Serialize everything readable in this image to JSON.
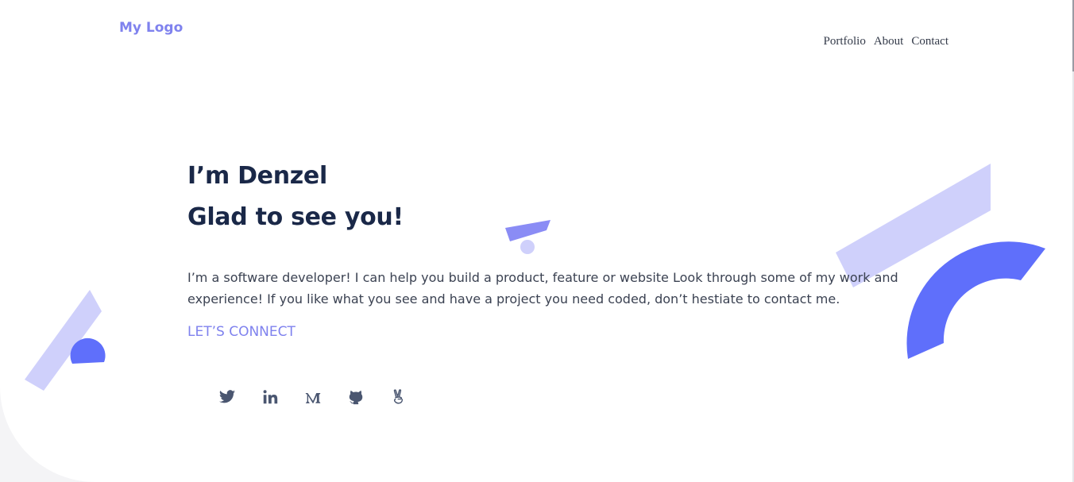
{
  "header": {
    "logo": "My Logo",
    "nav": [
      "Portfolio",
      "About",
      "Contact"
    ]
  },
  "hero": {
    "title_line1": "I’m Denzel",
    "title_line2": "Glad to see you!",
    "description": "I’m a software developer! I can help you build a product, feature or website Look through some of my work and experience! If you like what you see and have a project you need coded, don’t hestiate to contact me.",
    "cta": "LET’S CONNECT"
  },
  "socials": [
    {
      "name": "twitter-icon"
    },
    {
      "name": "linkedin-icon"
    },
    {
      "name": "medium-icon"
    },
    {
      "name": "github-icon"
    },
    {
      "name": "angellist-icon"
    }
  ],
  "colors": {
    "accent": "#7f82ee",
    "accent_light": "#cfd0fb",
    "accent_strong": "#5f6ffb",
    "heading": "#1a2848",
    "body_text": "#3b4252"
  }
}
